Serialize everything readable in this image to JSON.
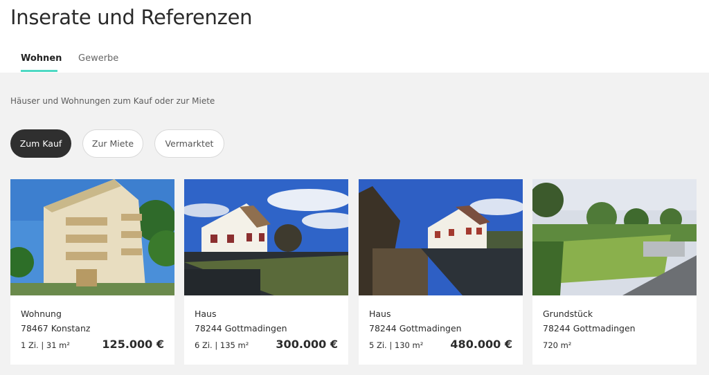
{
  "page": {
    "title": "Inserate und Referenzen"
  },
  "tabs": [
    {
      "label": "Wohnen",
      "active": true
    },
    {
      "label": "Gewerbe",
      "active": false
    }
  ],
  "subtitle": "Häuser und Wohnungen zum Kauf oder zur Miete",
  "filters": [
    {
      "label": "Zum Kauf",
      "active": true
    },
    {
      "label": "Zur Miete",
      "active": false
    },
    {
      "label": "Vermarktet",
      "active": false
    }
  ],
  "listings": [
    {
      "type": "Wohnung",
      "location": "78467 Konstanz",
      "meta": "1 Zi. | 31 m²",
      "price": "125.000 €"
    },
    {
      "type": "Haus",
      "location": "78244 Gottmadingen",
      "meta": "6 Zi. | 135 m²",
      "price": "300.000 €"
    },
    {
      "type": "Haus",
      "location": "78244 Gottmadingen",
      "meta": "5 Zi. | 130 m²",
      "price": "480.000 €"
    },
    {
      "type": "Grundstück",
      "location": "78244 Gottmadingen",
      "meta": "720 m²",
      "price": ""
    }
  ],
  "colors": {
    "accent": "#4dd9c3",
    "active_pill": "#2f2f2f",
    "background": "#f2f2f2"
  }
}
